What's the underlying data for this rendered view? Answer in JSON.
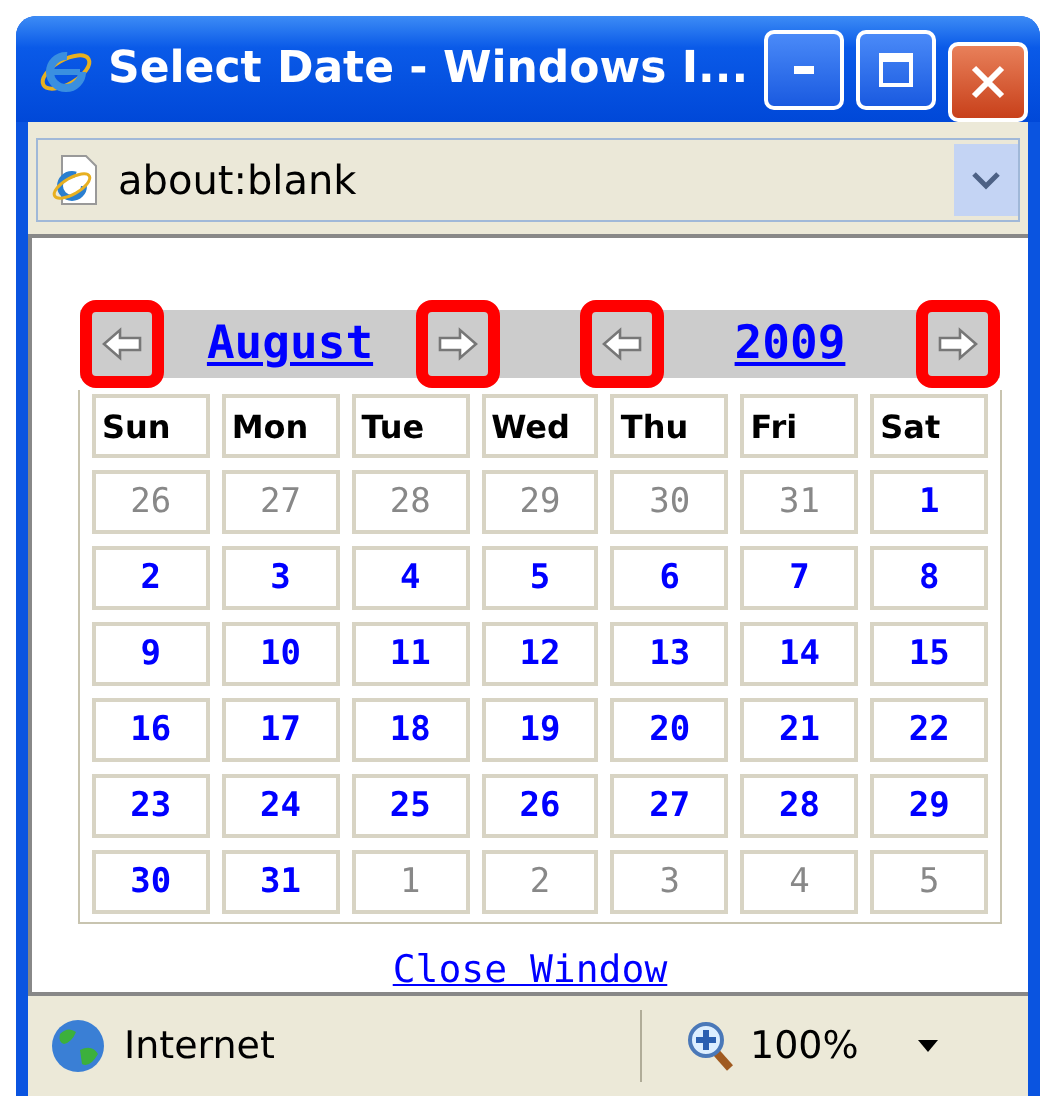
{
  "window": {
    "title": "Select Date - Windows I..."
  },
  "address_bar": {
    "value": "about:blank"
  },
  "calendar": {
    "month": {
      "label": "August",
      "prev": {
        "highlighted": true
      },
      "next": {
        "highlighted": true
      }
    },
    "year": {
      "label": "2009",
      "prev": {
        "highlighted": true
      },
      "next": {
        "highlighted": true
      }
    },
    "weekdays": [
      "Sun",
      "Mon",
      "Tue",
      "Wed",
      "Thu",
      "Fri",
      "Sat"
    ],
    "weeks": [
      [
        {
          "day": "26",
          "in_month": false
        },
        {
          "day": "27",
          "in_month": false
        },
        {
          "day": "28",
          "in_month": false
        },
        {
          "day": "29",
          "in_month": false
        },
        {
          "day": "30",
          "in_month": false
        },
        {
          "day": "31",
          "in_month": false
        },
        {
          "day": "1",
          "in_month": true
        }
      ],
      [
        {
          "day": "2",
          "in_month": true
        },
        {
          "day": "3",
          "in_month": true
        },
        {
          "day": "4",
          "in_month": true
        },
        {
          "day": "5",
          "in_month": true
        },
        {
          "day": "6",
          "in_month": true
        },
        {
          "day": "7",
          "in_month": true
        },
        {
          "day": "8",
          "in_month": true
        }
      ],
      [
        {
          "day": "9",
          "in_month": true
        },
        {
          "day": "10",
          "in_month": true
        },
        {
          "day": "11",
          "in_month": true
        },
        {
          "day": "12",
          "in_month": true
        },
        {
          "day": "13",
          "in_month": true
        },
        {
          "day": "14",
          "in_month": true
        },
        {
          "day": "15",
          "in_month": true
        }
      ],
      [
        {
          "day": "16",
          "in_month": true
        },
        {
          "day": "17",
          "in_month": true
        },
        {
          "day": "18",
          "in_month": true
        },
        {
          "day": "19",
          "in_month": true
        },
        {
          "day": "20",
          "in_month": true
        },
        {
          "day": "21",
          "in_month": true
        },
        {
          "day": "22",
          "in_month": true
        }
      ],
      [
        {
          "day": "23",
          "in_month": true
        },
        {
          "day": "24",
          "in_month": true
        },
        {
          "day": "25",
          "in_month": true
        },
        {
          "day": "26",
          "in_month": true
        },
        {
          "day": "27",
          "in_month": true
        },
        {
          "day": "28",
          "in_month": true
        },
        {
          "day": "29",
          "in_month": true
        }
      ],
      [
        {
          "day": "30",
          "in_month": true
        },
        {
          "day": "31",
          "in_month": true
        },
        {
          "day": "1",
          "in_month": false
        },
        {
          "day": "2",
          "in_month": false
        },
        {
          "day": "3",
          "in_month": false
        },
        {
          "day": "4",
          "in_month": false
        },
        {
          "day": "5",
          "in_month": false
        }
      ]
    ],
    "close_link": "Close Window"
  },
  "status_bar": {
    "zone": "Internet",
    "zoom": "100%"
  }
}
